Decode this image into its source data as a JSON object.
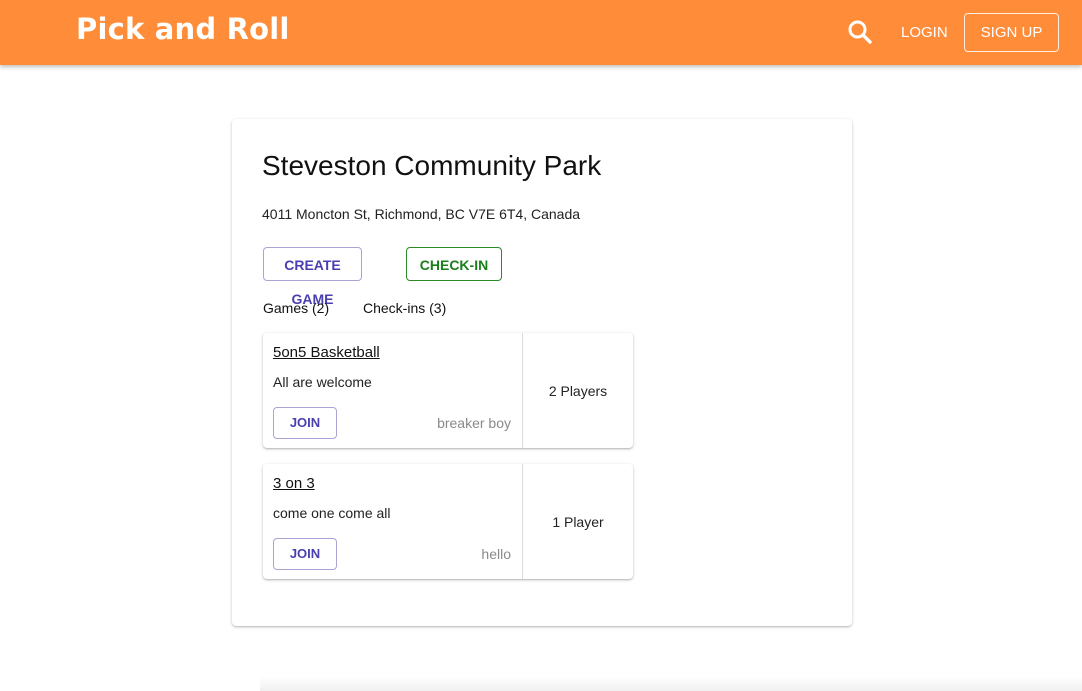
{
  "appbar": {
    "brand": "Pick and Roll",
    "search_icon": "search-icon",
    "login_label": "LOGIN",
    "signup_label": "SIGN UP",
    "color": "#ff8c38"
  },
  "park": {
    "name": "Steveston Community Park",
    "address": "4011 Moncton St, Richmond, BC V7E 6T4, Canada",
    "create_game_label": "CREATE GAME",
    "checkin_label": "CHECK-IN",
    "tabs": [
      {
        "label": "Games (2)"
      },
      {
        "label": "Check-ins (3)"
      }
    ]
  },
  "games": [
    {
      "title": "5on5 Basketball",
      "description": "All are welcome",
      "join_label": "JOIN",
      "host": "breaker boy",
      "players": "2 Players"
    },
    {
      "title": "3 on 3",
      "description": "come one come all",
      "join_label": "JOIN",
      "host": "hello",
      "players": "1 Player"
    }
  ]
}
